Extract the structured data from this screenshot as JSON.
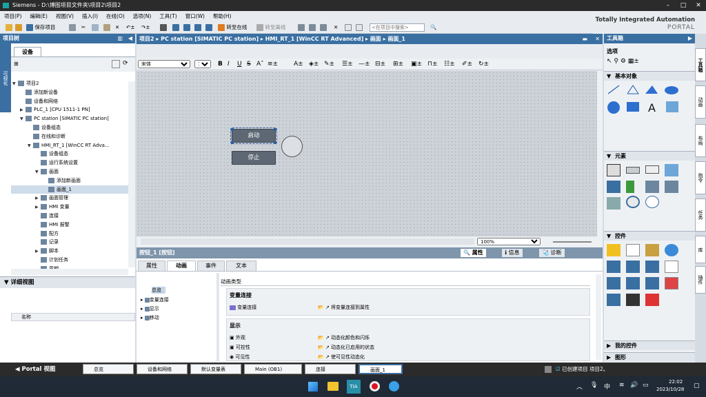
{
  "window": {
    "title": "Siemens  -  D:\\博图项目文件夹\\项目2\\项目2"
  },
  "menu": [
    "项目(P)",
    "编辑(E)",
    "视图(V)",
    "插入(I)",
    "在线(O)",
    "选项(N)",
    "工具(T)",
    "窗口(W)",
    "帮助(H)"
  ],
  "toolbar": {
    "save_project": "保存项目",
    "go_online": "转至在线",
    "go_offline": "转至离线",
    "search_placeholder": "<在项目中搜索>"
  },
  "brand": {
    "line1": "Totally Integrated Automation",
    "line2": "PORTAL"
  },
  "project_tree": {
    "title": "项目树",
    "vertical_tab": "可视化",
    "devices_tab": "设备",
    "items": [
      {
        "label": "项目2",
        "indent": 0,
        "arrow": "▼"
      },
      {
        "label": "添加新设备",
        "indent": 1,
        "arrow": ""
      },
      {
        "label": "设备和网络",
        "indent": 1,
        "arrow": ""
      },
      {
        "label": "PLC_1 [CPU 1511-1 PN]",
        "indent": 1,
        "arrow": "▶"
      },
      {
        "label": "PC station [SIMATIC PC station]",
        "indent": 1,
        "arrow": "▼"
      },
      {
        "label": "设备组态",
        "indent": 2,
        "arrow": ""
      },
      {
        "label": "在线和诊断",
        "indent": 2,
        "arrow": ""
      },
      {
        "label": "HMI_RT_1 [WinCC RT Adva...",
        "indent": 2,
        "arrow": "▼"
      },
      {
        "label": "设备组态",
        "indent": 3,
        "arrow": ""
      },
      {
        "label": "运行系统设置",
        "indent": 3,
        "arrow": ""
      },
      {
        "label": "画面",
        "indent": 3,
        "arrow": "▼"
      },
      {
        "label": "添加新画面",
        "indent": 4,
        "arrow": ""
      },
      {
        "label": "画面_1",
        "indent": 4,
        "arrow": ""
      },
      {
        "label": "画面管理",
        "indent": 3,
        "arrow": "▶"
      },
      {
        "label": "HMI 变量",
        "indent": 3,
        "arrow": "▶"
      },
      {
        "label": "连接",
        "indent": 3,
        "arrow": ""
      },
      {
        "label": "HMI 报警",
        "indent": 3,
        "arrow": ""
      },
      {
        "label": "配方",
        "indent": 3,
        "arrow": ""
      },
      {
        "label": "记录",
        "indent": 3,
        "arrow": ""
      },
      {
        "label": "脚本",
        "indent": 3,
        "arrow": "▶"
      },
      {
        "label": "计划任务",
        "indent": 3,
        "arrow": ""
      },
      {
        "label": "周期",
        "indent": 3,
        "arrow": ""
      }
    ]
  },
  "detail_view": {
    "title": "详细视图",
    "name_col": "名称"
  },
  "editor": {
    "breadcrumb": "项目2  ▸  PC station [SIMATIC PC station]  ▸  HMI_RT_1 [WinCC RT Advanced]  ▸  画面  ▸  画面_1",
    "font": "宋体",
    "font_size": "15",
    "zoom": "100%",
    "start_button": "启动",
    "stop_button": "停止"
  },
  "properties": {
    "title": "按钮_1 [按钮]",
    "tabs": [
      "属性",
      "动画",
      "事件",
      "文本"
    ],
    "active_tab": "动画",
    "right_tabs": [
      "属性",
      "信息",
      "诊断"
    ],
    "nav": [
      "总览",
      "变量连接",
      "显示",
      "移动"
    ],
    "anim_type": "动画类型",
    "var_section": "变量连接",
    "var_item": "变量连接",
    "var_action": "将变量连接到属性",
    "disp_section": "显示",
    "disp_items": [
      "外观",
      "可控性",
      "可见性"
    ],
    "disp_actions": [
      "动态化颜色和闪烁",
      "动态化已启用的状态",
      "使可见性动态化"
    ]
  },
  "toolbox": {
    "title": "工具箱",
    "select": "选项",
    "basic_objects": "基本对象",
    "elements": "元素",
    "controls": "控件",
    "my_controls": "我的控件",
    "graphics": "图形"
  },
  "right_tabs": [
    "工具箱",
    "动画",
    "布局",
    "指令",
    "任务",
    "库",
    "插件"
  ],
  "portal_bar": {
    "portal_view": "Portal 视图",
    "tasks": [
      "总览",
      "设备和网络",
      "默认变量表",
      "Main (OB1)",
      "连接",
      "画面_1"
    ],
    "status": "已创建项目 项目2。"
  },
  "taskbar": {
    "ime": "中",
    "time": "22:02",
    "date": "2023/10/28"
  }
}
